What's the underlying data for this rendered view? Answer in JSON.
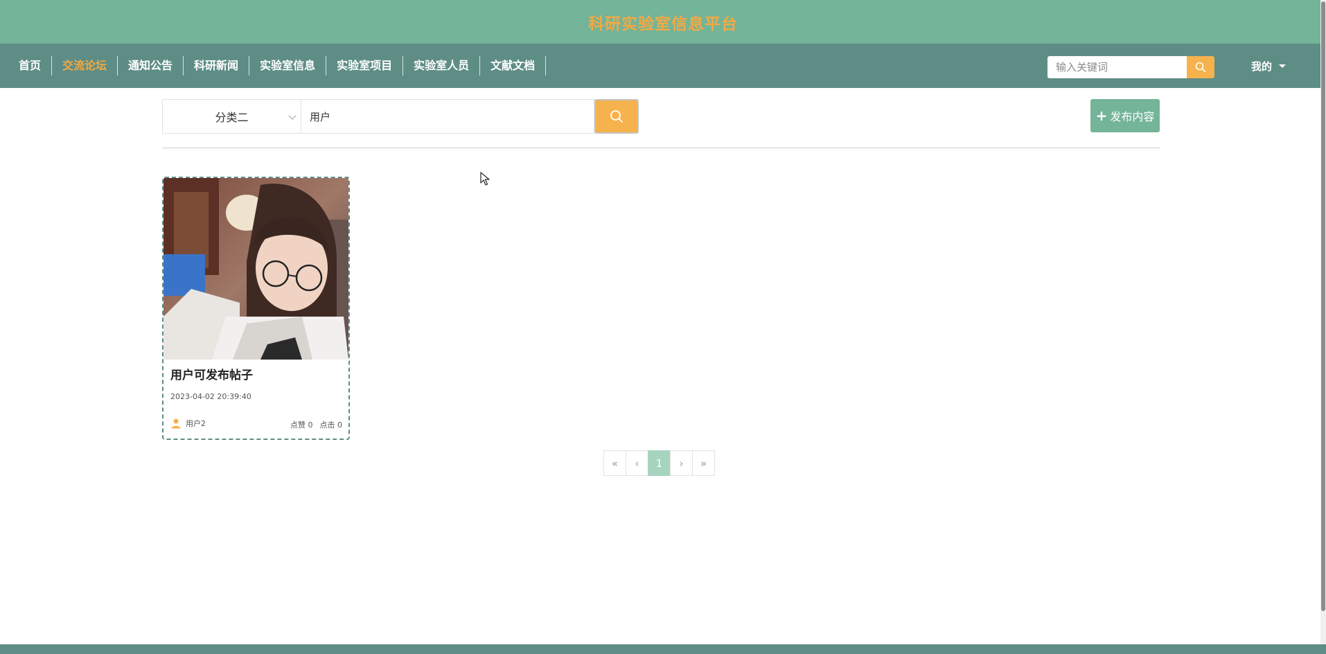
{
  "header": {
    "site_title": "科研实验室信息平台"
  },
  "nav": {
    "items": [
      {
        "label": "首页",
        "active": false
      },
      {
        "label": "交流论坛",
        "active": true
      },
      {
        "label": "通知公告",
        "active": false
      },
      {
        "label": "科研新闻",
        "active": false
      },
      {
        "label": "实验室信息",
        "active": false
      },
      {
        "label": "实验室项目",
        "active": false
      },
      {
        "label": "实验室人员",
        "active": false
      },
      {
        "label": "文献文档",
        "active": false
      }
    ],
    "search_placeholder": "输入关键词",
    "user_menu_label": "我的"
  },
  "filter": {
    "category_selected": "分类二",
    "keyword_value": "用户",
    "publish_label": "发布内容"
  },
  "posts": [
    {
      "title": "用户可发布帖子",
      "time": "2023-04-02 20:39:40",
      "author": "用户2",
      "likes_text": "点赞 0",
      "clicks_text": "点击 0"
    }
  ],
  "pagination": {
    "first": "«",
    "prev": "‹",
    "current": "1",
    "next": "›",
    "last": "»"
  },
  "colors": {
    "title_band": "#74b498",
    "nav_band": "#5e8d86",
    "accent_orange": "#f6b24c",
    "title_text": "#f2a944",
    "page_active": "#a6d4bf"
  },
  "icons": [
    "search-icon",
    "caret-down-icon",
    "chevron-down-icon",
    "plus-icon",
    "user-icon"
  ]
}
